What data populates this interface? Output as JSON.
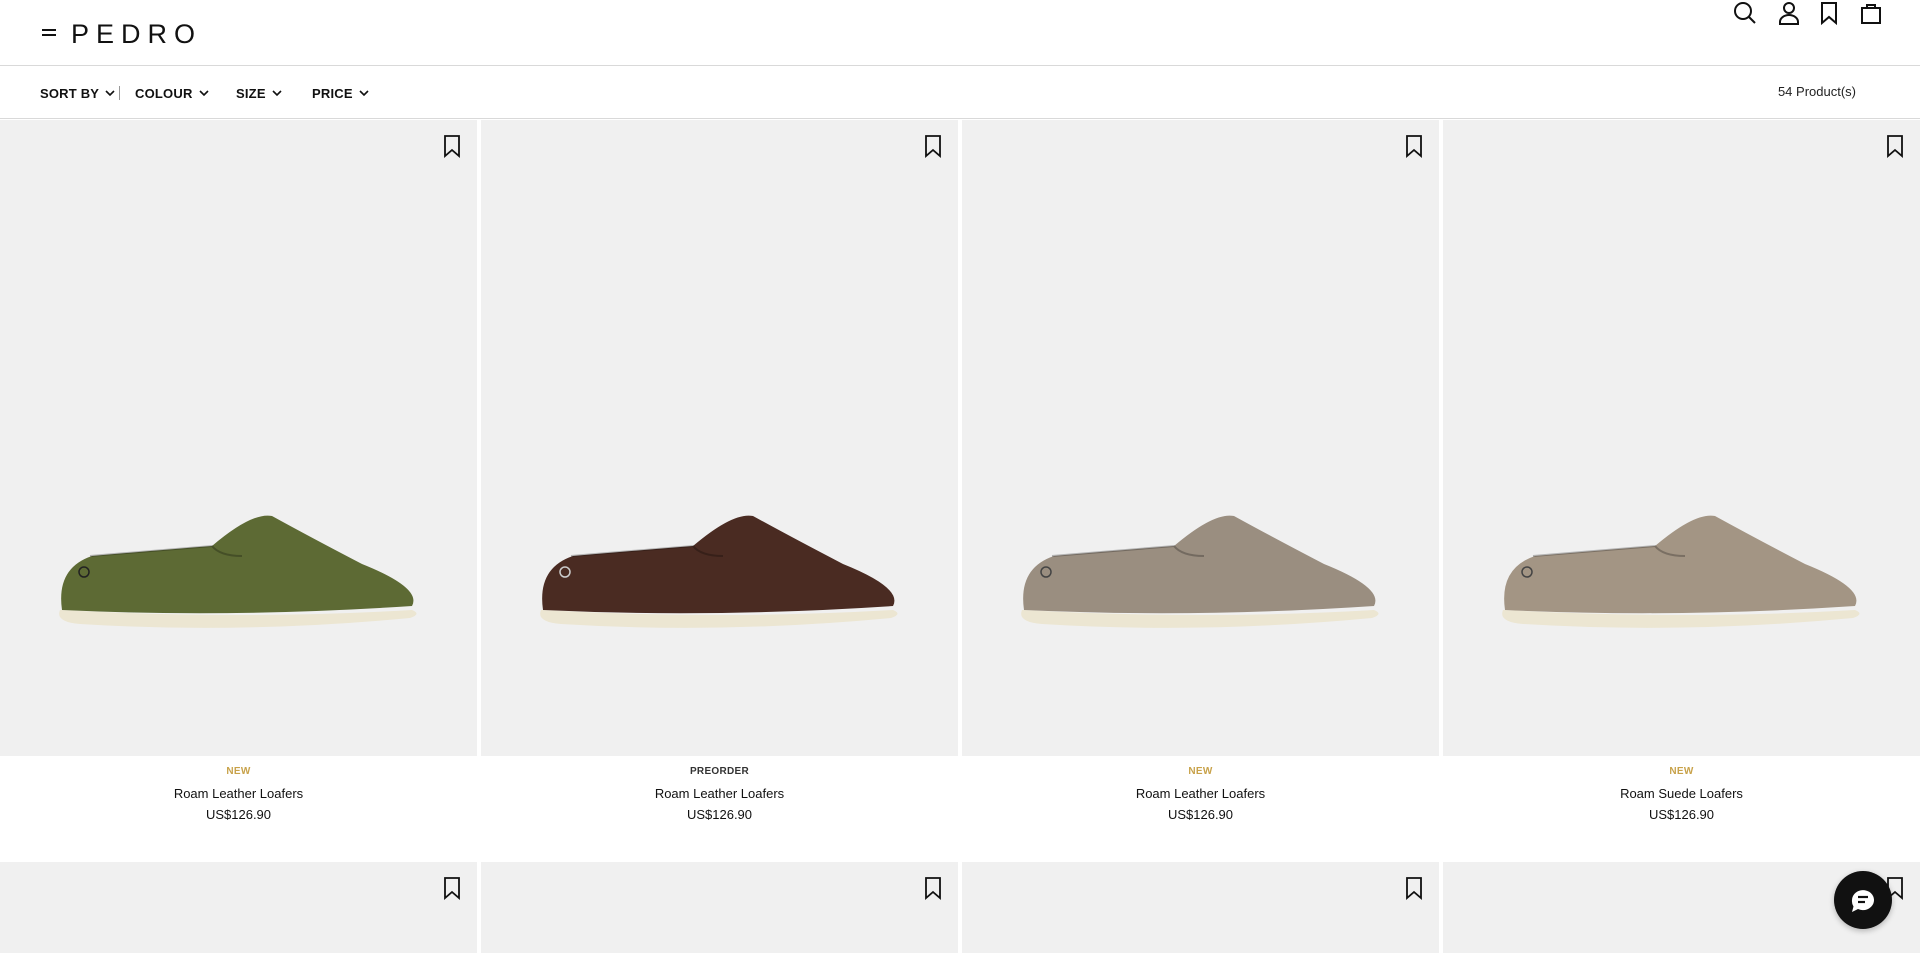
{
  "header": {
    "logo": "PEDRO",
    "icons": [
      "search-icon",
      "account-icon",
      "wishlist-icon",
      "bag-icon"
    ]
  },
  "filters": {
    "sort_label": "SORT BY",
    "colour_label": "COLOUR",
    "size_label": "SIZE",
    "price_label": "PRICE",
    "count": "54 Product(s)"
  },
  "products": [
    {
      "badge": "NEW",
      "badge_color": "#c8a24a",
      "name": "Roam Leather Loafers",
      "price": "US$126.90",
      "color": "#5d6a34"
    },
    {
      "badge": "PREORDER",
      "badge_color": "#333333",
      "name": "Roam Leather Loafers",
      "price": "US$126.90",
      "color": "#4a2b22"
    },
    {
      "badge": "NEW",
      "badge_color": "#c8a24a",
      "name": "Roam Leather Loafers",
      "price": "US$126.90",
      "color": "#9a8e80"
    },
    {
      "badge": "NEW",
      "badge_color": "#c8a24a",
      "name": "Roam Suede Loafers",
      "price": "US$126.90",
      "color": "#a39584"
    }
  ],
  "colors": {
    "image_bg": "#f0f0f0",
    "sole": "#ece6d2",
    "chat_bg": "#111111"
  }
}
